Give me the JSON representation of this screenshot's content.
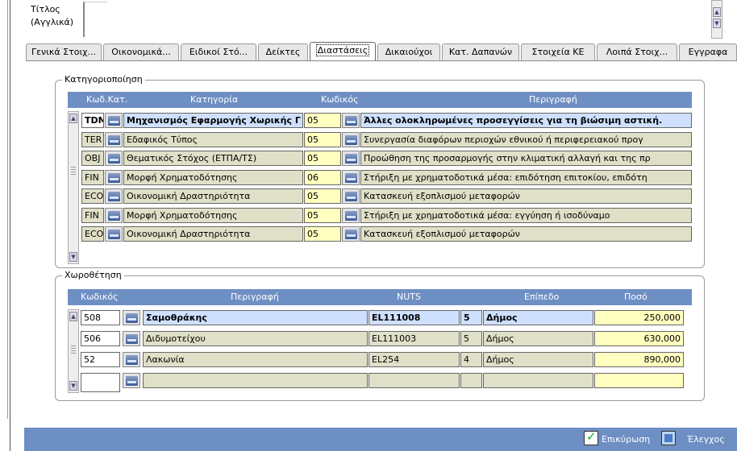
{
  "title_field": {
    "label_line1": "Τίτλος",
    "label_line2": "(Αγγλικά)"
  },
  "tabs": [
    "Γενικά Στοιχ...",
    "Οικονομικά...",
    "Ειδικοί Στό...",
    "Δείκτες",
    "Διαστάσεις",
    "Δικαιούχοι",
    "Κατ. Δαπανών",
    "Στοιχεία ΚΕ",
    "Λοιπά Στοιχ...",
    "Εγγραφα"
  ],
  "active_tab": "Διαστάσεις",
  "categorization": {
    "legend": "Κατηγοριοποίηση",
    "headers": {
      "code_cat": "Κωδ.Κατ.",
      "category": "Κατηγορία",
      "code": "Κωδικός",
      "description": "Περιγραφή"
    },
    "rows": [
      {
        "code_cat": "TDM",
        "category": "Μηχανισμός Εφαρμογής Χωρικής Γ",
        "code": "05",
        "description": "Άλλες ολοκληρωμένες προσεγγίσεις για τη βιώσιμη αστική."
      },
      {
        "code_cat": "TER",
        "category": "Εδαφικός Τύπος",
        "code": "05",
        "description": "Συνεργασία διαφόρων περιοχών εθνικού ή περιφερειακού προγ"
      },
      {
        "code_cat": "OBJ",
        "category": "Θεματικός Στόχος (ΕΤΠΑ/ΤΣ)",
        "code": "05",
        "description": "Προώθηση της προσαρμογής στην κλιματική αλλαγή και της πρ"
      },
      {
        "code_cat": "FIN",
        "category": "Μορφή Χρηματοδότησης",
        "code": "06",
        "description": "Στήριξη με χρηματοδοτικά μέσα: επιδότηση επιτοκίου, επιδότη"
      },
      {
        "code_cat": "ECO",
        "category": "Οικονομική Δραστηριότητα",
        "code": "05",
        "description": "Κατασκευή εξοπλισμού μεταφορών"
      },
      {
        "code_cat": "FIN",
        "category": "Μορφή Χρηματοδότησης",
        "code": "05",
        "description": "Στήριξη με χρηματοδοτικά μέσα: εγγύηση ή ισοδύναμο"
      },
      {
        "code_cat": "ECO",
        "category": "Οικονομική Δραστηριότητα",
        "code": "05",
        "description": "Κατασκευή εξοπλισμού μεταφορών"
      }
    ]
  },
  "location": {
    "legend": "Χωροθέτηση",
    "headers": {
      "code": "Κωδικός",
      "description": "Περιγραφή",
      "nuts": "NUTS",
      "level": "Επίπεδο",
      "amount": "Ποσό"
    },
    "rows": [
      {
        "code": "508",
        "description": "Σαμοθράκης",
        "nuts": "EL111008",
        "level_num": "5",
        "level": "Δήμος",
        "amount": "250,000"
      },
      {
        "code": "506",
        "description": "Διδυμοτείχου",
        "nuts": "EL111003",
        "level_num": "5",
        "level": "Δήμος",
        "amount": "630,000"
      },
      {
        "code": "52",
        "description": "Λακωνία",
        "nuts": "EL254",
        "level_num": "4",
        "level": "Δήμος",
        "amount": "890,000"
      },
      {
        "code": "",
        "description": "",
        "nuts": "",
        "level_num": "",
        "level": "",
        "amount": ""
      }
    ]
  },
  "status_bar": {
    "confirm_label": "Επικύρωση",
    "check_label": "Έλεγχος"
  }
}
